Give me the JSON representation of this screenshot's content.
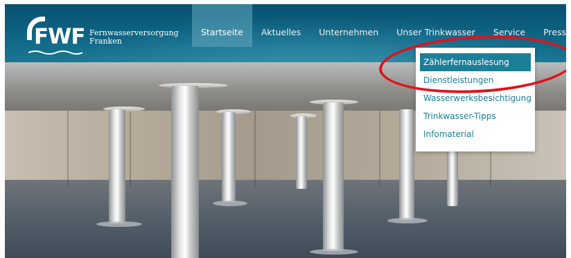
{
  "brand": {
    "logo_text": "FWF",
    "name_line1": "Fernwasserversorgung",
    "name_line2": "Franken"
  },
  "nav": {
    "items": [
      {
        "label": "Startseite",
        "active": true
      },
      {
        "label": "Aktuelles",
        "active": false
      },
      {
        "label": "Unternehmen",
        "active": false
      },
      {
        "label": "Unser Trinkwasser",
        "active": false
      },
      {
        "label": "Service",
        "active": false
      },
      {
        "label": "Presse",
        "active": false
      }
    ]
  },
  "dropdown": {
    "items": [
      {
        "label": "Zählerfernauslesung",
        "highlighted": true
      },
      {
        "label": "Dienstleistungen",
        "highlighted": false
      },
      {
        "label": "Wasserwerksbesichtigung",
        "highlighted": false
      },
      {
        "label": "Trinkwasser-Tipps",
        "highlighted": false
      },
      {
        "label": "Infomaterial",
        "highlighted": false
      }
    ]
  },
  "annotation": {
    "color": "#e0121d"
  },
  "colors": {
    "header": "#0e6584",
    "accent": "#1c7f98"
  }
}
